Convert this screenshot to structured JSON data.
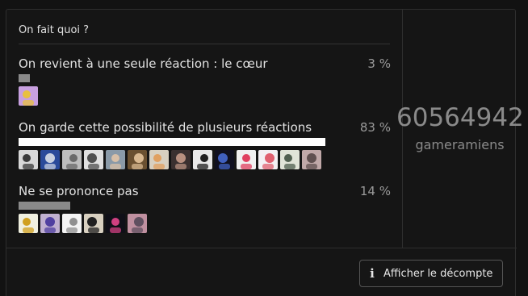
{
  "poll": {
    "question": "On fait quoi ?",
    "options": [
      {
        "label": "On revient à une seule réaction : le cœur",
        "percent_label": "3 %",
        "percent": 3,
        "leading": false,
        "voters": [
          {
            "icon": "cartoon-character-avatar",
            "colors": [
              "#c8a0e0",
              "#e8c040"
            ]
          }
        ]
      },
      {
        "label": "On garde cette possibilité de plusieurs réactions",
        "percent_label": "83 %",
        "percent": 83,
        "leading": true,
        "voters": [
          {
            "icon": "bw-portrait-avatar",
            "colors": [
              "#d8d8d8",
              "#3a3a3a"
            ]
          },
          {
            "icon": "blue-artwork-avatar",
            "colors": [
              "#2a4a9a",
              "#c8d0e0"
            ]
          },
          {
            "icon": "sketch-face-avatar",
            "colors": [
              "#bdbdbd",
              "#6a6a6a"
            ]
          },
          {
            "icon": "bw-art-avatar",
            "colors": [
              "#e0e0e0",
              "#505050"
            ]
          },
          {
            "icon": "man-portrait-avatar",
            "colors": [
              "#8a9aa8",
              "#d8c0a8"
            ]
          },
          {
            "icon": "man-hat-avatar",
            "colors": [
              "#6a5030",
              "#d8b890"
            ]
          },
          {
            "icon": "cartoon-dog-avatar",
            "colors": [
              "#d8d0c0",
              "#e0a060"
            ]
          },
          {
            "icon": "dark-portrait-avatar",
            "colors": [
              "#3a3030",
              "#b89080"
            ]
          },
          {
            "icon": "suit-man-avatar",
            "colors": [
              "#e8e8e8",
              "#202020"
            ]
          },
          {
            "icon": "oz-logo-avatar",
            "colors": [
              "#101020",
              "#4060c0"
            ]
          },
          {
            "icon": "pixel-character-avatar",
            "colors": [
              "#f0f0f0",
              "#e04060"
            ]
          },
          {
            "icon": "balloon-drawing-avatar",
            "colors": [
              "#f4f0f4",
              "#e06070"
            ]
          },
          {
            "icon": "drawn-face-avatar",
            "colors": [
              "#e0e4d8",
              "#506050"
            ]
          },
          {
            "icon": "photo-portrait-avatar",
            "colors": [
              "#c0a8a8",
              "#605050"
            ]
          }
        ]
      },
      {
        "label": "Ne se prononce pas",
        "percent_label": "14 %",
        "percent": 14,
        "leading": false,
        "voters": [
          {
            "icon": "cartoon-duck-avatar",
            "colors": [
              "#f0f0e0",
              "#d0a020"
            ]
          },
          {
            "icon": "wizard-avatar",
            "colors": [
              "#c0b0d0",
              "#5040a0"
            ]
          },
          {
            "icon": "white-creature-avatar",
            "colors": [
              "#f4f4f4",
              "#909090"
            ]
          },
          {
            "icon": "tree-silhouette-avatar",
            "colors": [
              "#d8d0c0",
              "#202020"
            ]
          },
          {
            "icon": "neon-figure-avatar",
            "colors": [
              "#101018",
              "#d04080"
            ]
          },
          {
            "icon": "person-portrait-avatar",
            "colors": [
              "#c090a0",
              "#605060"
            ]
          }
        ]
      }
    ],
    "total": {
      "number": "60564942",
      "unit": "gameramiens"
    },
    "count_button": {
      "label": "Afficher le décompte",
      "icon": "info-icon"
    }
  }
}
